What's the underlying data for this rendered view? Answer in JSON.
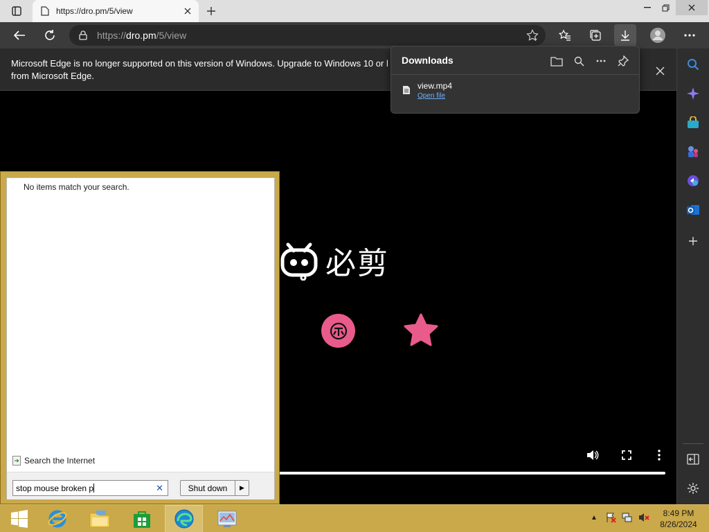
{
  "browser": {
    "tab_title": "https://dro.pm/5/view",
    "url_prefix": "https://",
    "url_host": "dro.pm",
    "url_path": "/5/view"
  },
  "infobar": {
    "message": "Microsoft Edge is no longer supported on this version of Windows. Upgrade to Windows 10 or l",
    "message_line2": "from Microsoft Edge."
  },
  "downloads": {
    "title": "Downloads",
    "items": [
      {
        "name": "view.mp4",
        "action": "Open file"
      }
    ]
  },
  "video": {
    "logo_text": "必剪",
    "progress": 1.0
  },
  "start_menu": {
    "no_items": "No items match your search.",
    "search_internet": "Search the Internet",
    "search_value": "stop mouse broken p",
    "shutdown_label": "Shut down"
  },
  "taskbar": {
    "time": "8:49 PM",
    "date": "8/26/2024",
    "apps": [
      "windows-start",
      "internet-explorer",
      "file-explorer",
      "store",
      "edge",
      "control-panel"
    ]
  },
  "colors": {
    "taskbar": "#c9a94a",
    "pink": "#e85b8a",
    "link": "#6fb1ff"
  }
}
